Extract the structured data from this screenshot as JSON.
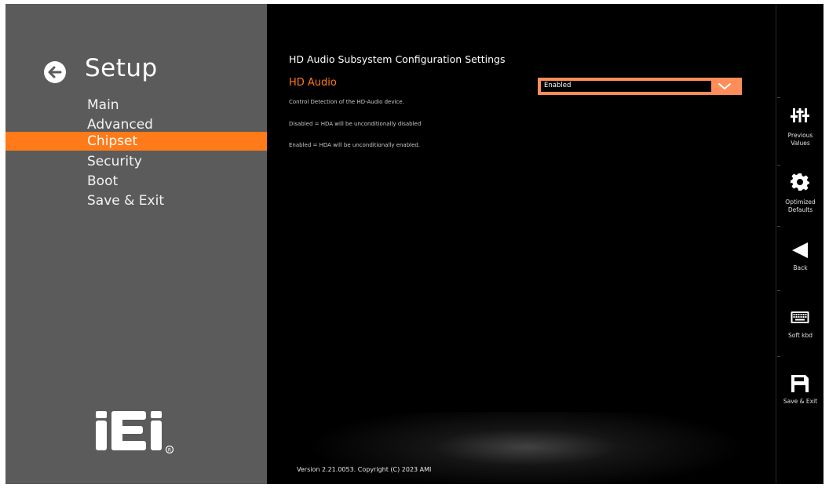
{
  "nav": {
    "title": "Setup",
    "items": [
      {
        "label": "Main"
      },
      {
        "label": "Advanced"
      },
      {
        "label": "Chipset"
      },
      {
        "label": "Security"
      },
      {
        "label": "Boot"
      },
      {
        "label": "Save & Exit"
      }
    ],
    "active_item": "Chipset"
  },
  "main": {
    "section_title": "HD Audio Subsystem Configuration Settings",
    "setting": {
      "label": "HD Audio",
      "value": "Enabled"
    },
    "help_lines": [
      "Control Detection of the HD-Audio device.",
      "Disabled = HDA will be unconditionally disabled",
      "Enabled = HDA will be unconditionally enabled."
    ],
    "version": "Version 2.21.0053. Copyright (C) 2023 AMI"
  },
  "sidebar": {
    "buttons": [
      {
        "label_line1": "Previous",
        "label_line2": "Values",
        "icon": "sliders-icon"
      },
      {
        "label_line1": "Optimized",
        "label_line2": "Defaults",
        "icon": "gear-icon"
      },
      {
        "label_line1": "Back",
        "label_line2": "",
        "icon": "back-triangle-icon"
      },
      {
        "label_line1": "Soft kbd",
        "label_line2": "",
        "icon": "keyboard-icon"
      },
      {
        "label_line1": "Save & Exit",
        "label_line2": "",
        "icon": "floppy-save-icon"
      }
    ]
  },
  "colors": {
    "accent": "#ff7a18",
    "select_border": "#ff8d5a",
    "left_panel": "#5b5b5b",
    "background": "#000000"
  }
}
